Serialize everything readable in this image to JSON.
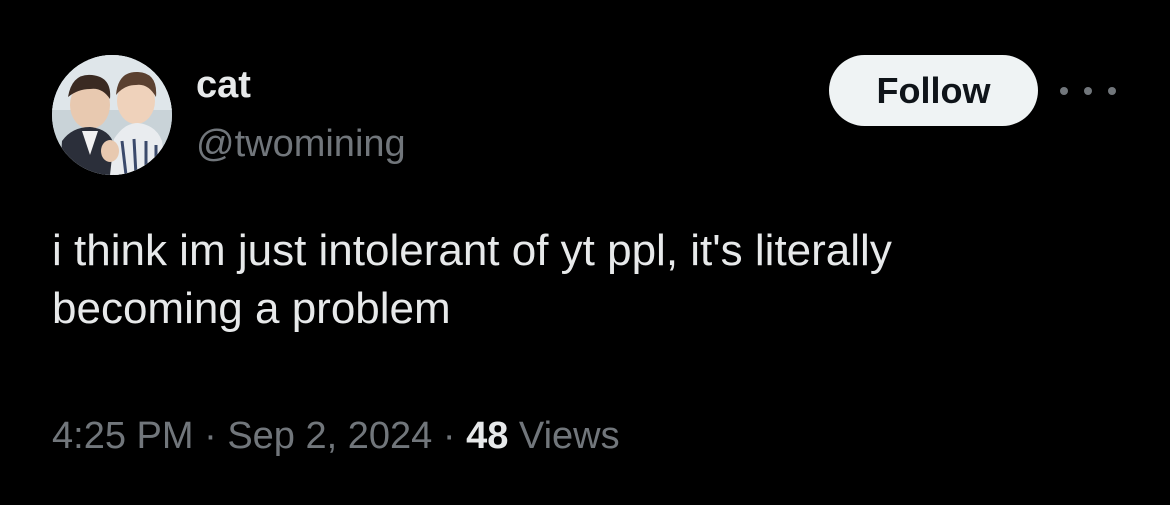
{
  "author": {
    "display_name": "cat",
    "handle": "@twomining",
    "avatar_icon": "profile-photo"
  },
  "actions": {
    "follow_label": "Follow",
    "more_icon": "more-dots-icon"
  },
  "tweet": {
    "text": "i think im just intolerant of yt ppl, it's literally\nbecoming a problem",
    "time": "4:25 PM",
    "separator": " · ",
    "date": "Sep 2, 2024",
    "views_count": "48",
    "views_label": "Views"
  },
  "colors": {
    "background": "#000000",
    "primary_text": "#e7e9ea",
    "secondary_text": "#71767b",
    "follow_bg": "#eff3f4",
    "follow_text": "#0f1419"
  }
}
